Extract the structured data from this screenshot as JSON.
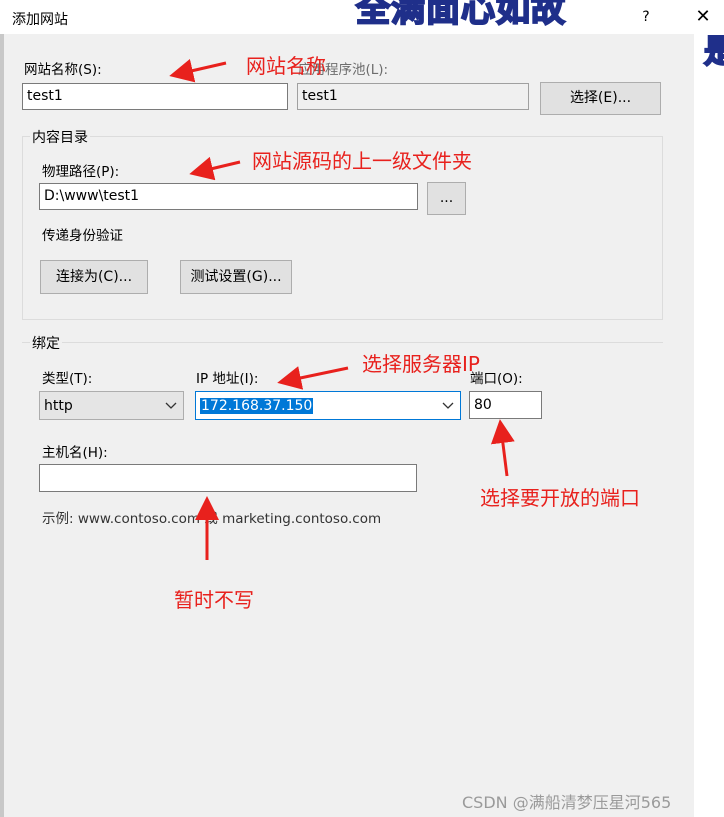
{
  "window": {
    "title": "添加网站",
    "help_label": "?",
    "close_label": "✕",
    "banner_text": "全满面心如故",
    "banner_side": "是"
  },
  "site": {
    "name_label": "网站名称(S):",
    "name_value": "test1",
    "pool_label": "应用程序池(L):",
    "pool_value": "test1",
    "select_button": "选择(E)..."
  },
  "content_dir": {
    "group_title": "内容目录",
    "path_label": "物理路径(P):",
    "path_value": "D:\\www\\test1",
    "browse_button": "...",
    "auth_label": "传递身份验证",
    "connect_button": "连接为(C)...",
    "test_button": "测试设置(G)..."
  },
  "binding": {
    "group_title": "绑定",
    "type_label": "类型(T):",
    "type_value": "http",
    "ip_label": "IP 地址(I):",
    "ip_value": "172.168.37.150",
    "port_label": "端口(O):",
    "port_value": "80",
    "host_label": "主机名(H):",
    "host_value": "",
    "example_text": "示例: www.contoso.com 或 marketing.contoso.com"
  },
  "annotations": {
    "site_name": "网站名称",
    "source_folder": "网站源码的上一级文件夹",
    "server_ip": "选择服务器IP",
    "open_port": "选择要开放的端口",
    "hostname_note": "暂时不写"
  },
  "watermark": "CSDN @满船清梦压星河565",
  "colors": {
    "annotation_red": "#e8211d",
    "selection_blue": "#0078d7",
    "dialog_bg": "#f0f0f0"
  }
}
